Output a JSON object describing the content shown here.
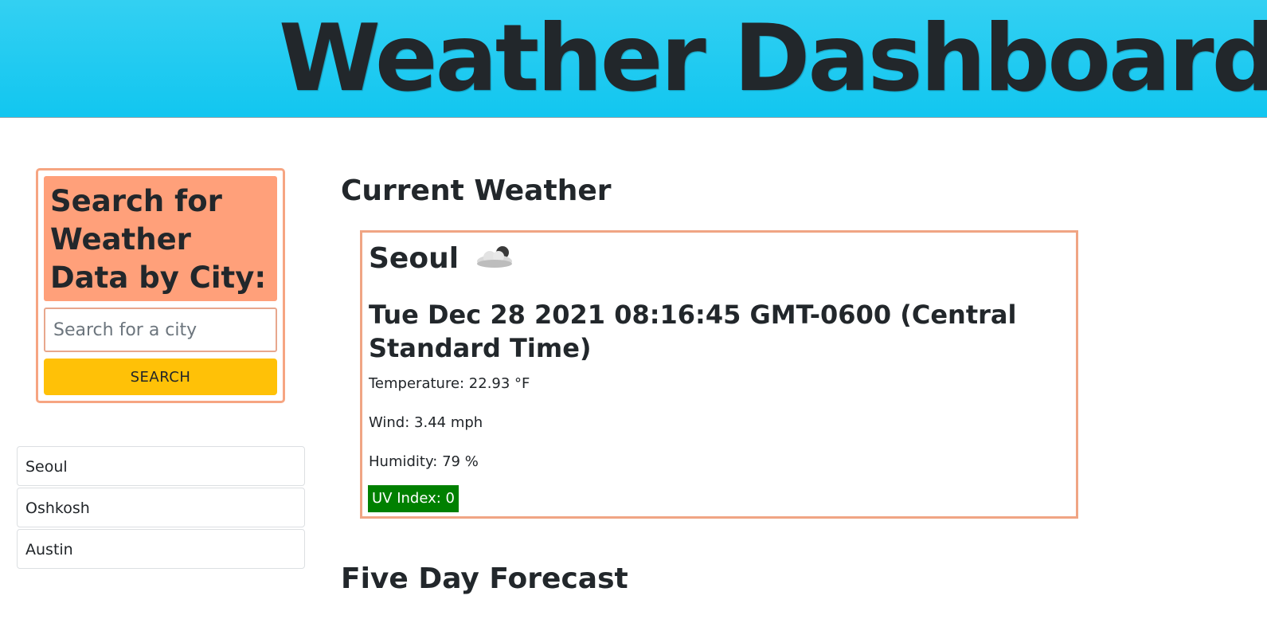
{
  "header": {
    "title": "Weather Dashboard",
    "gradient_top": "#33d0f2",
    "gradient_bottom": "#12c6f0"
  },
  "search": {
    "heading": "Search for Weather Data by City:",
    "placeholder": "Search for a city",
    "value": "",
    "button_label": "SEARCH",
    "accent_color": "#ffa07a",
    "button_color": "#ffc107"
  },
  "history": {
    "items": [
      {
        "label": "Seoul"
      },
      {
        "label": "Oshkosh"
      },
      {
        "label": "Austin"
      }
    ]
  },
  "main": {
    "current_section_title": "Current Weather",
    "forecast_section_title": "Five Day Forecast"
  },
  "current": {
    "city": "Seoul",
    "icon": "cloud-icon",
    "datetime": "Tue Dec 28 2021 08:16:45 GMT-0600 (Central Standard Time)",
    "temperature": "Temperature: 22.93 °F",
    "wind": "Wind: 3.44 mph",
    "humidity": "Humidity: 79 %",
    "uv_index": "UV Index: 0",
    "uv_color": "#008000"
  }
}
